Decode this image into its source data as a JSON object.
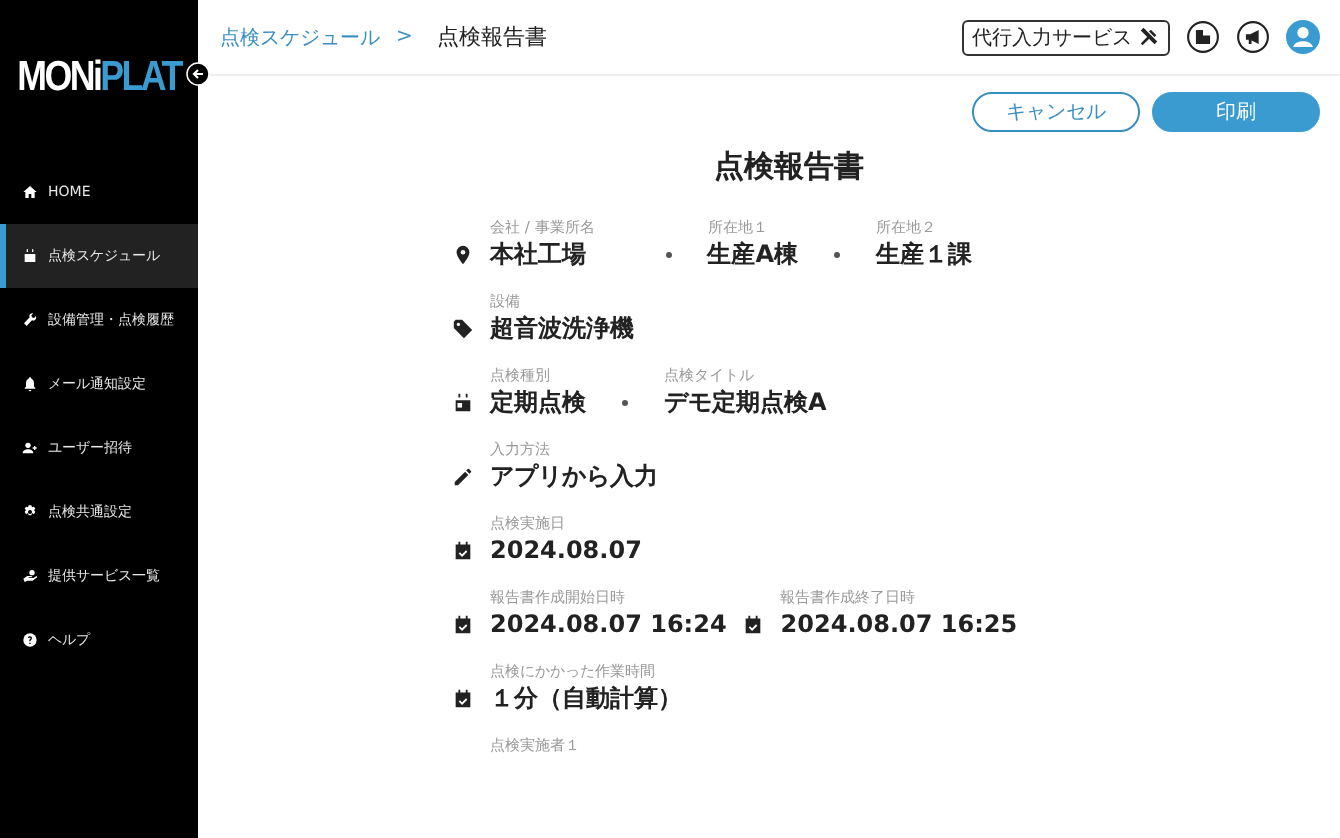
{
  "sidebar": {
    "logo": {
      "part_1": "MONi",
      "part_2": "PLAT"
    },
    "items": [
      {
        "label": "HOME",
        "kind": "home",
        "selected": false
      },
      {
        "label": "点検スケジュール",
        "kind": "calendar",
        "selected": true
      },
      {
        "label": "設備管理・点検履歴",
        "kind": "wrench",
        "selected": false
      },
      {
        "label": "メール通知設定",
        "kind": "bell",
        "selected": false
      },
      {
        "label": "ユーザー招待",
        "kind": "user-add",
        "selected": false
      },
      {
        "label": "点検共通設定",
        "kind": "gear",
        "selected": false
      },
      {
        "label": "提供サービス一覧",
        "kind": "hand",
        "selected": false
      },
      {
        "label": "ヘルプ",
        "kind": "help",
        "selected": false
      }
    ]
  },
  "header": {
    "breadcrumb": {
      "parent": "点検スケジュール",
      "separator": ">",
      "current": "点検報告書"
    },
    "service_button": "代行入力サービス"
  },
  "actions": [
    {
      "label": "キャンセル",
      "kind": "outline"
    },
    {
      "label": "印刷",
      "kind": "primary"
    }
  ],
  "report": {
    "title": "点検報告書",
    "rows": [
      {
        "groups": [
          {
            "kind": "pin",
            "fields": [
              {
                "label": "会社 / 事業所名",
                "value": "本社工場"
              },
              {
                "label": "所在地１",
                "value": "生産A棟"
              },
              {
                "label": "所在地２",
                "value": "生産１課"
              }
            ]
          }
        ]
      },
      {
        "groups": [
          {
            "kind": "tag",
            "fields": [
              {
                "label": "設備",
                "value": "超音波洗浄機"
              }
            ]
          }
        ]
      },
      {
        "groups": [
          {
            "kind": "calendar",
            "fields": [
              {
                "label": "点検種別",
                "value": "定期点検"
              },
              {
                "label": "点検タイトル",
                "value": "デモ定期点検A"
              }
            ]
          }
        ]
      },
      {
        "groups": [
          {
            "kind": "pencil",
            "fields": [
              {
                "label": "入力方法",
                "value": "アプリから入力"
              }
            ]
          }
        ]
      },
      {
        "groups": [
          {
            "kind": "calendar-check",
            "fields": [
              {
                "label": "点検実施日",
                "value": "2024.08.07"
              }
            ]
          }
        ]
      },
      {
        "groups": [
          {
            "kind": "calendar-check",
            "fields": [
              {
                "label": "報告書作成開始日時",
                "value": "2024.08.07 16:24"
              }
            ]
          },
          {
            "kind": "calendar-check",
            "fields": [
              {
                "label": "報告書作成終了日時",
                "value": "2024.08.07 16:25"
              }
            ]
          }
        ]
      },
      {
        "groups": [
          {
            "kind": "calendar-check",
            "fields": [
              {
                "label": "点検にかかった作業時間",
                "value": "１分（自動計算）"
              }
            ]
          }
        ]
      },
      {
        "groups": [
          {
            "fields": [
              {
                "label": "点検実施者１"
              }
            ]
          }
        ]
      }
    ]
  }
}
